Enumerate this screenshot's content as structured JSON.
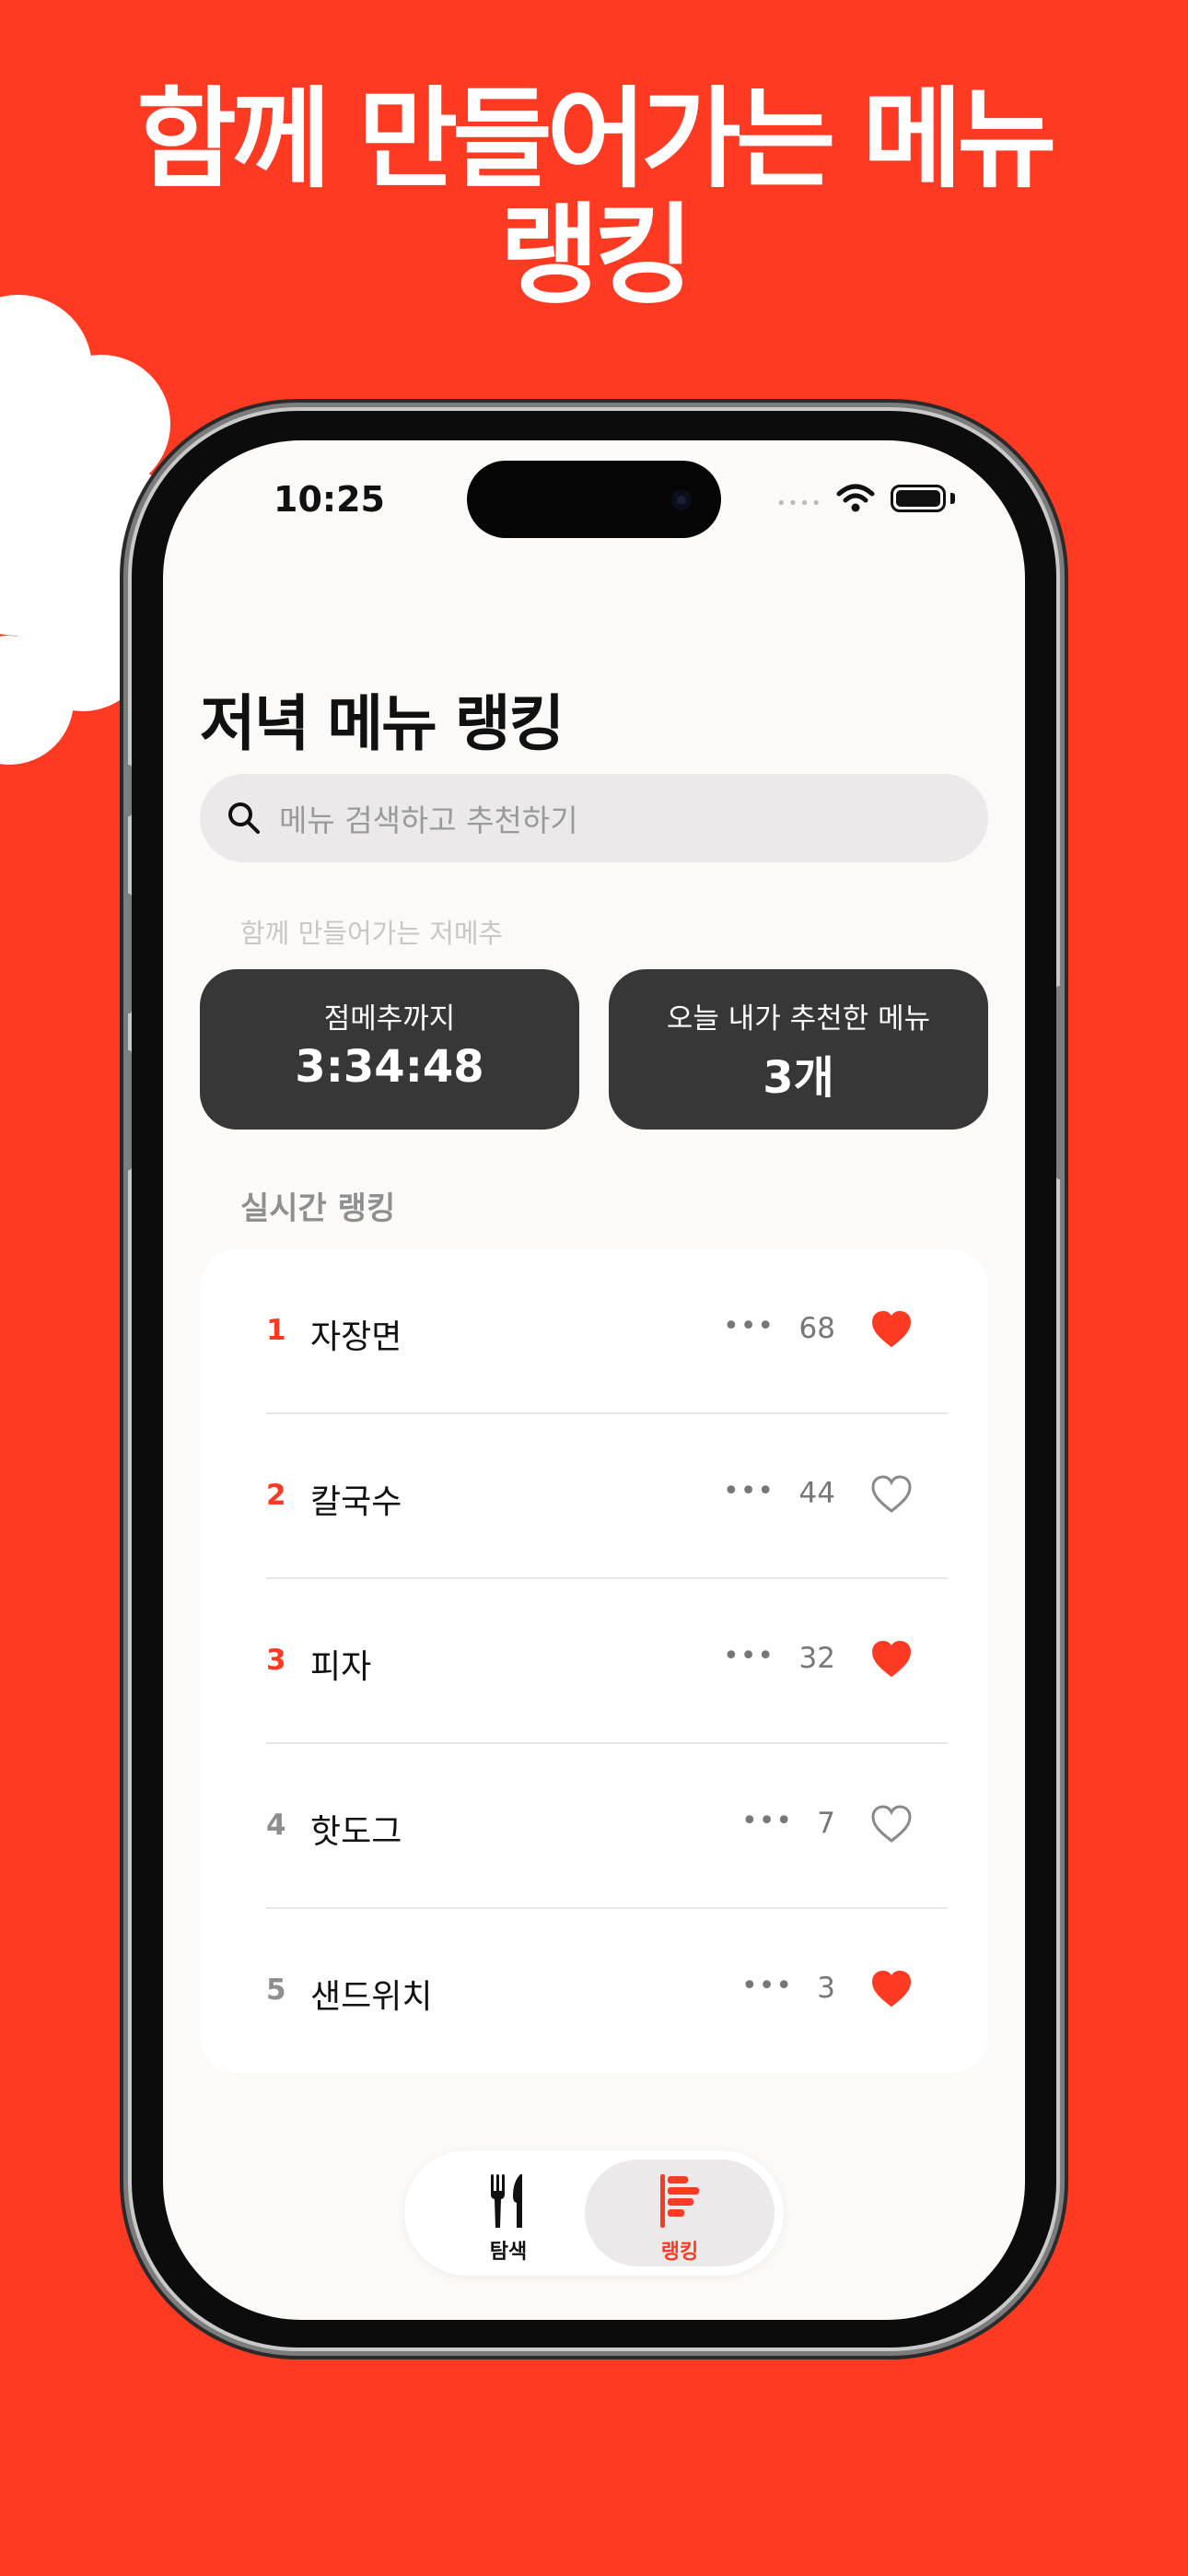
{
  "headline": {
    "line1": "함께 만들어가는 메뉴",
    "line2": "랭킹"
  },
  "status_bar": {
    "time": "10:25",
    "dots": "••••"
  },
  "page_title": "저녁 메뉴 랭킹",
  "search": {
    "placeholder": "메뉴 검색하고 추천하기"
  },
  "subtitle": "함께 만들어가는 저메추",
  "stats": [
    {
      "label": "점메추까지",
      "value": "3:34:48"
    },
    {
      "label": "오늘 내가 추천한 메뉴",
      "value": "3개"
    }
  ],
  "section_label": "실시간 랭킹",
  "rankings": [
    {
      "rank": "1",
      "name": "자장면",
      "more": "•••",
      "count": "68",
      "liked": true
    },
    {
      "rank": "2",
      "name": "칼국수",
      "more": "•••",
      "count": "44",
      "liked": false
    },
    {
      "rank": "3",
      "name": "피자",
      "more": "•••",
      "count": "32",
      "liked": true
    },
    {
      "rank": "4",
      "name": "핫도그",
      "more": "•••",
      "count": "7",
      "liked": false
    },
    {
      "rank": "5",
      "name": "샌드위치",
      "more": "•••",
      "count": "3",
      "liked": true
    }
  ],
  "tabs": [
    {
      "label": "탐색",
      "icon": "fork-knife-icon",
      "active": false
    },
    {
      "label": "랭킹",
      "icon": "ranking-bars-icon",
      "active": true
    }
  ],
  "colors": {
    "background": "#ff3a22",
    "accent": "#ff3a22",
    "top_rank": "#ff3a22",
    "other_rank": "#8e8e8e",
    "card_dark": "#373737"
  }
}
